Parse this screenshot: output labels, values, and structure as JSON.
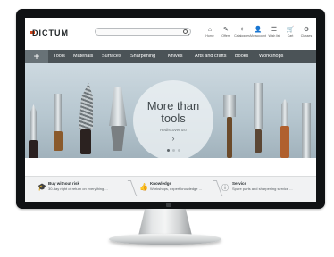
{
  "header": {
    "logo": "DICTUM",
    "search_placeholder": "",
    "nav": [
      {
        "icon": "home-icon",
        "glyph": "⌂",
        "label": "Home"
      },
      {
        "icon": "pencil-icon",
        "glyph": "✎",
        "label": "Offers"
      },
      {
        "icon": "catalogues-icon",
        "glyph": "✧",
        "label": "Catalogues"
      },
      {
        "icon": "user-icon",
        "glyph": "👤",
        "label": "My account"
      },
      {
        "icon": "wishlist-icon",
        "glyph": "☰",
        "label": "Wish list"
      },
      {
        "icon": "cart-icon",
        "glyph": "🛒",
        "label": "Cart"
      },
      {
        "icon": "classes-icon",
        "glyph": "⚙",
        "label": "Classes"
      }
    ]
  },
  "categories": {
    "plus": "+",
    "items": [
      "Tools",
      "Materials",
      "Surfaces",
      "Sharpening",
      "Knives",
      "Arts and crafts",
      "Books",
      "Workshops"
    ]
  },
  "hero": {
    "title_line1": "More than",
    "title_line2": "tools",
    "subtitle": "Rediscover us!",
    "arrow": "›",
    "slide_count": 3,
    "active_slide": 1
  },
  "benefits": [
    {
      "icon": "graduation-cap-icon",
      "glyph": "🎓",
      "title": "Buy without risk",
      "desc": "30-day right of return on everything ..."
    },
    {
      "icon": "thumbs-up-icon",
      "glyph": "👍",
      "title": "Knowledge",
      "desc": "Workshops, expert knowledge ..."
    },
    {
      "icon": "info-icon",
      "glyph": "ⓘ",
      "title": "Service",
      "desc": "Spare parts and sharpening service ..."
    }
  ],
  "colors": {
    "nav_bg": "#4b5357",
    "accent": "#d0451b",
    "bezel": "#101214"
  }
}
